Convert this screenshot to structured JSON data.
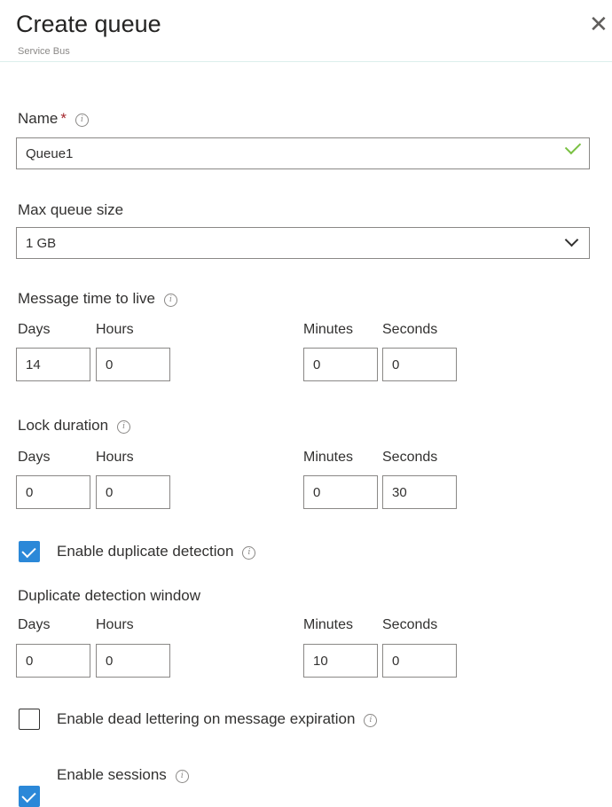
{
  "header": {
    "title": "Create queue",
    "subtitle": "Service Bus",
    "close_icon": "close-icon"
  },
  "name": {
    "label": "Name",
    "required_mark": "*",
    "value": "Queue1"
  },
  "max_queue_size": {
    "label": "Max queue size",
    "value": "1 GB"
  },
  "message_ttl": {
    "label": "Message time to live",
    "days_label": "Days",
    "hours_label": "Hours",
    "minutes_label": "Minutes",
    "seconds_label": "Seconds",
    "days": "14",
    "hours": "0",
    "minutes": "0",
    "seconds": "0"
  },
  "lock_duration": {
    "label": "Lock duration",
    "days_label": "Days",
    "hours_label": "Hours",
    "minutes_label": "Minutes",
    "seconds_label": "Seconds",
    "days": "0",
    "hours": "0",
    "minutes": "0",
    "seconds": "30"
  },
  "duplicate_detection": {
    "label": "Enable duplicate detection",
    "checked": true
  },
  "duplicate_window": {
    "label": "Duplicate detection window",
    "days_label": "Days",
    "hours_label": "Hours",
    "minutes_label": "Minutes",
    "seconds_label": "Seconds",
    "days": "0",
    "hours": "0",
    "minutes": "10",
    "seconds": "0"
  },
  "dead_lettering": {
    "label": "Enable dead lettering on message expiration",
    "checked": false
  },
  "sessions": {
    "label": "Enable sessions",
    "checked": true
  },
  "colors": {
    "accent": "#2b88d8",
    "valid": "#7ac143",
    "required": "#a4262c"
  }
}
